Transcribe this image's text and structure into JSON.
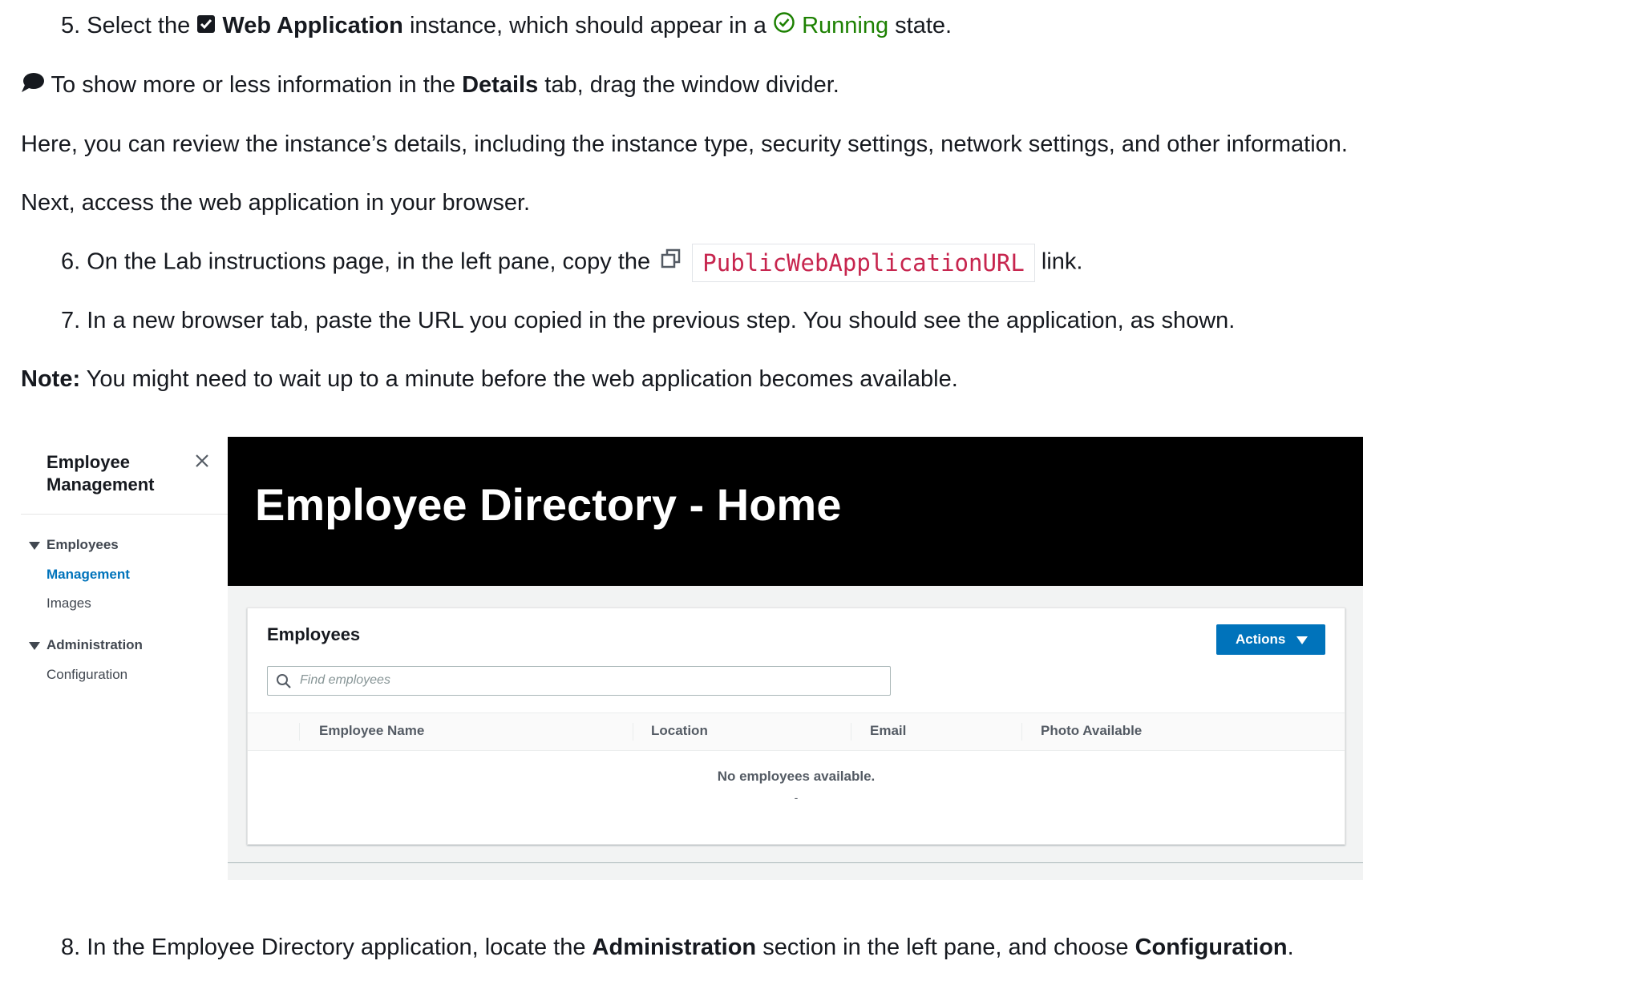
{
  "step5": {
    "prefix": "5. Select the",
    "instance": "Web Application",
    "mid": "instance, which should appear in a",
    "state": "Running",
    "suffix": "state."
  },
  "tip": {
    "prefix": "To show more or less information in the",
    "tab": "Details",
    "suffix": "tab, drag the window divider."
  },
  "para1": "Here, you can review the instance’s details, including the instance type, security settings, network settings, and other information.",
  "para2": "Next, access the web application in your browser.",
  "step6": {
    "prefix": "6. On the Lab instructions page, in the left pane, copy the",
    "code": "PublicWebApplicationURL",
    "suffix": "link."
  },
  "step7": "7. In a new browser tab, paste the URL you copied in the previous step. You should see the application, as shown.",
  "note": {
    "label": "Note:",
    "text": "You might need to wait up to a minute before the web application becomes available."
  },
  "app": {
    "sidebar": {
      "title_line1": "Employee",
      "title_line2": "Management",
      "sections": [
        {
          "label": "Employees",
          "links": [
            "Management",
            "Images"
          ]
        },
        {
          "label": "Administration",
          "links": [
            "Configuration"
          ]
        }
      ]
    },
    "hero_title": "Employee Directory - Home",
    "panel_title": "Employees",
    "actions_label": "Actions",
    "search_placeholder": "Find employees",
    "columns": [
      "Employee Name",
      "Location",
      "Email",
      "Photo Available"
    ],
    "empty_text": "No employees available.",
    "empty_dash": "-"
  },
  "step8": {
    "prefix": "8. In the Employee Directory application, locate the",
    "section": "Administration",
    "mid": "section in the left pane, and choose",
    "item": "Configuration",
    "suffix": "."
  },
  "colors": {
    "running": "#1d8102",
    "code": "#c7254e",
    "link": "#0073bb",
    "button": "#0073bb"
  }
}
